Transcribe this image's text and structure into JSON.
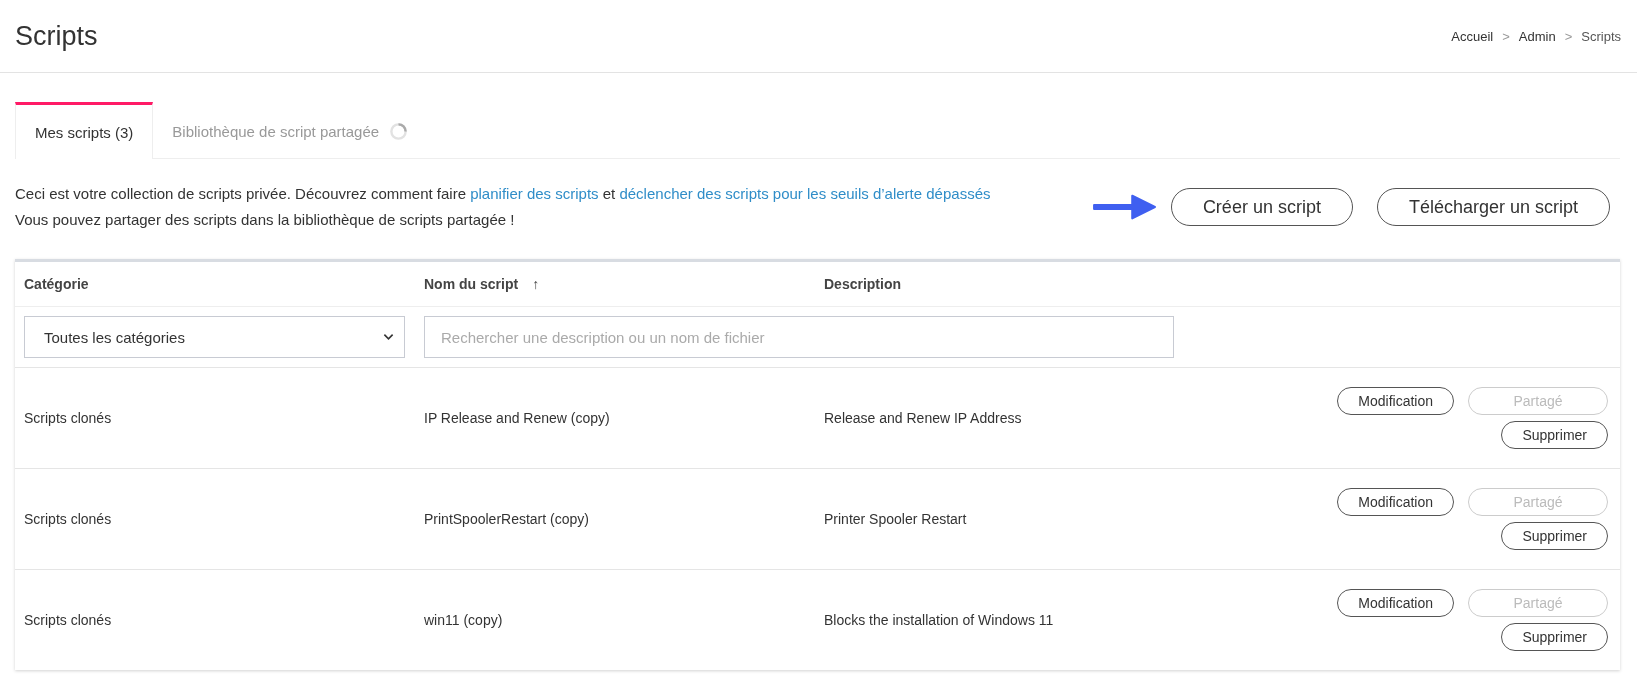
{
  "page": {
    "title": "Scripts"
  },
  "breadcrumb": {
    "separator": ">",
    "items": [
      {
        "label": "Accueil",
        "current": false
      },
      {
        "label": "Admin",
        "current": false
      },
      {
        "label": "Scripts",
        "current": true
      }
    ]
  },
  "tabs": [
    {
      "label": "Mes scripts (3)",
      "selected": true,
      "loading": false
    },
    {
      "label": "Bibliothèque de script partagée",
      "selected": false,
      "loading": true
    }
  ],
  "intro": {
    "lines": [
      [
        {
          "text": "Ceci est votre collection de scripts privée. Découvrez comment faire ",
          "link": false
        },
        {
          "text": "planifier des scripts",
          "link": true
        },
        {
          "text": " et ",
          "link": false
        },
        {
          "text": "déclencher des scripts pour les seuils d’alerte dépassés",
          "link": true
        }
      ],
      [
        {
          "text": "Vous pouvez partager des scripts dans la bibliothèque de scripts partagée !",
          "link": false
        }
      ]
    ]
  },
  "actions": [
    {
      "label": "Créer un script",
      "pointer": true
    },
    {
      "label": "Télécharger un script",
      "pointer": false
    }
  ],
  "table": {
    "columns": [
      {
        "label": "Catégorie"
      },
      {
        "label": "Nom du script",
        "sort": "↑"
      },
      {
        "label": "Description"
      }
    ],
    "filters": {
      "category": "Toutes les catégories",
      "search_placeholder": "Rechercher une description ou un nom de fichier"
    },
    "rows": [
      {
        "category": "Scripts clonés",
        "name": "IP Release and Renew (copy)",
        "description": "Release and Renew IP Address",
        "buttons": [
          {
            "label": "Modification",
            "disabled": false
          },
          {
            "label": "Partagé",
            "disabled": true
          },
          {
            "label": "Supprimer",
            "disabled": false
          }
        ]
      },
      {
        "category": "Scripts clonés",
        "name": "PrintSpoolerRestart (copy)",
        "description": "Printer Spooler Restart",
        "buttons": [
          {
            "label": "Modification",
            "disabled": false
          },
          {
            "label": "Partagé",
            "disabled": true
          },
          {
            "label": "Supprimer",
            "disabled": false
          }
        ]
      },
      {
        "category": "Scripts clonés",
        "name": "win11 (copy)",
        "description": "Blocks the installation of Windows 11",
        "buttons": [
          {
            "label": "Modification",
            "disabled": false
          },
          {
            "label": "Partagé",
            "disabled": true
          },
          {
            "label": "Supprimer",
            "disabled": false
          }
        ]
      }
    ]
  }
}
